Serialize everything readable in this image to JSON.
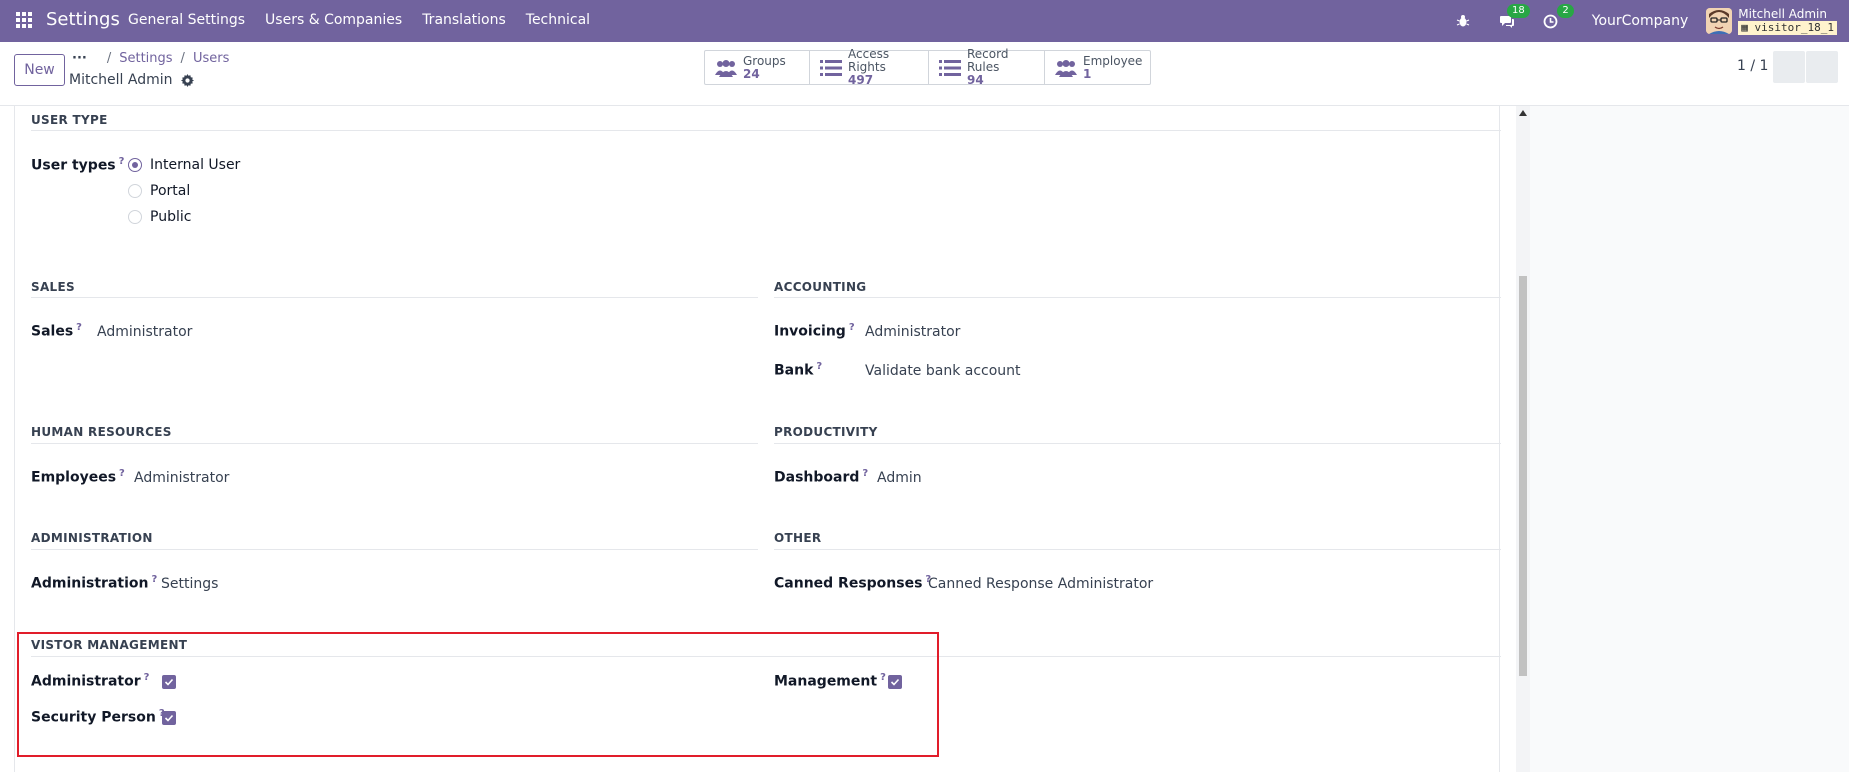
{
  "navbar": {
    "app_title": "Settings",
    "menu": [
      "General Settings",
      "Users & Companies",
      "Translations",
      "Technical"
    ],
    "messages_badge": "18",
    "activities_badge": "2",
    "company": "YourCompany",
    "user_name": "Mitchell Admin",
    "db_name": "visitor_18_1"
  },
  "control_panel": {
    "new_label": "New",
    "breadcrumb": [
      "Settings",
      "Users"
    ],
    "record_title": "Mitchell Admin",
    "pager": "1 / 1",
    "stats": [
      {
        "label": "Groups",
        "value": "24"
      },
      {
        "label": "Access Rights",
        "value": "497"
      },
      {
        "label": "Record Rules",
        "value": "94"
      },
      {
        "label": "Employee",
        "value": "1"
      }
    ]
  },
  "form": {
    "user_type": {
      "title": "USER TYPE",
      "label": "User types",
      "options": [
        "Internal User",
        "Portal",
        "Public"
      ],
      "selected": "Internal User"
    },
    "sales": {
      "title": "SALES",
      "fields": [
        {
          "label": "Sales",
          "value": "Administrator"
        }
      ]
    },
    "accounting": {
      "title": "ACCOUNTING",
      "fields": [
        {
          "label": "Invoicing",
          "value": "Administrator"
        },
        {
          "label": "Bank",
          "value": "Validate bank account"
        }
      ]
    },
    "human_resources": {
      "title": "HUMAN RESOURCES",
      "fields": [
        {
          "label": "Employees",
          "value": "Administrator"
        }
      ]
    },
    "productivity": {
      "title": "PRODUCTIVITY",
      "fields": [
        {
          "label": "Dashboard",
          "value": "Admin"
        }
      ]
    },
    "administration": {
      "title": "ADMINISTRATION",
      "fields": [
        {
          "label": "Administration",
          "value": "Settings"
        }
      ]
    },
    "other": {
      "title": "OTHER",
      "fields": [
        {
          "label": "Canned Responses",
          "value": "Canned Response Administrator"
        }
      ]
    },
    "visitor_management": {
      "title": "VISTOR MANAGEMENT",
      "fields": [
        {
          "label": "Administrator",
          "checked": true
        },
        {
          "label": "Security Person",
          "checked": true
        },
        {
          "label": "Management",
          "checked": true
        }
      ]
    },
    "help_marker": "?"
  },
  "colors": {
    "brand": "#71639e",
    "highlight": "#e11d2a",
    "badge": "#28a745"
  }
}
